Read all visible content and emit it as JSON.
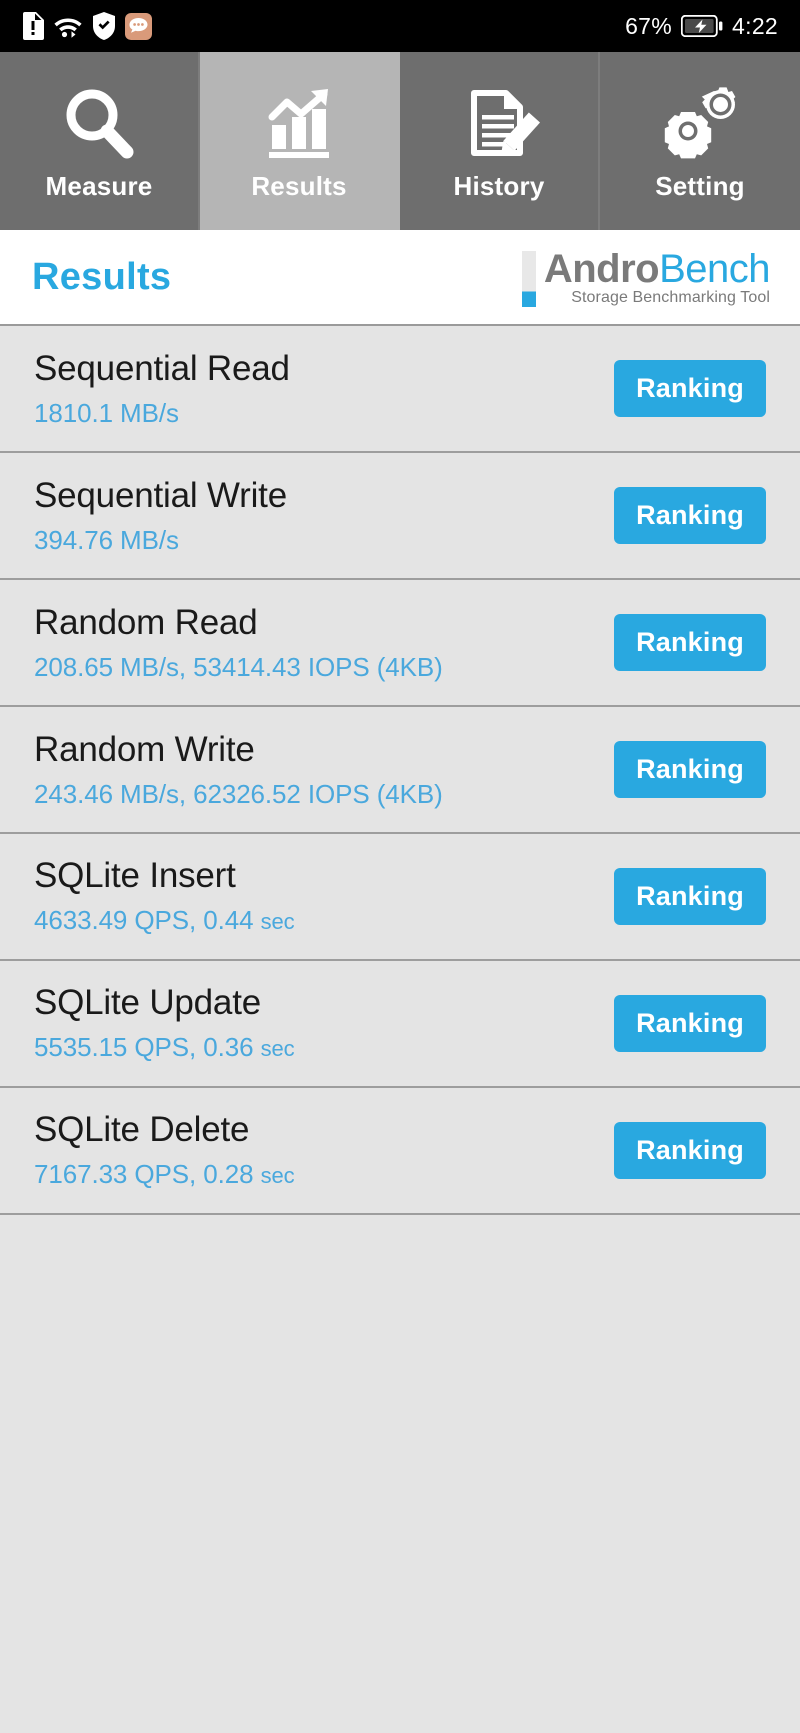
{
  "statusbar": {
    "icons_left": [
      "sim-alert-icon",
      "wifi-icon",
      "shield-check-icon",
      "message-bubble-icon"
    ],
    "battery_percent": "67%",
    "battery_icon": "battery-charging-icon",
    "time": "4:22"
  },
  "tabs": [
    {
      "id": "measure",
      "label": "Measure",
      "icon": "magnifier-icon",
      "active": false
    },
    {
      "id": "results",
      "label": "Results",
      "icon": "bar-chart-arrow-icon",
      "active": true
    },
    {
      "id": "history",
      "label": "History",
      "icon": "document-pencil-icon",
      "active": false
    },
    {
      "id": "setting",
      "label": "Setting",
      "icon": "gears-icon",
      "active": false
    }
  ],
  "header": {
    "title": "Results",
    "brand_first": "Andro",
    "brand_second": "Bench",
    "brand_tagline": "Storage Benchmarking Tool"
  },
  "colors": {
    "accent_blue": "#29a8e0",
    "value_blue": "#4aa8dd",
    "tab_inactive": "#6e6e6e",
    "tab_active": "#b5b5b5",
    "row_bg": "#e4e4e4",
    "brand_gray": "#7a7a7a"
  },
  "results": {
    "button_label": "Ranking",
    "rows": [
      {
        "name": "Sequential Read",
        "value": "1810.1 MB/s"
      },
      {
        "name": "Sequential Write",
        "value": "394.76 MB/s"
      },
      {
        "name": "Random Read",
        "value": "208.65 MB/s, 53414.43 IOPS (4KB)"
      },
      {
        "name": "Random Write",
        "value": "243.46 MB/s, 62326.52 IOPS (4KB)"
      },
      {
        "name": "SQLite Insert",
        "value": "4633.49 QPS, 0.44 sec"
      },
      {
        "name": "SQLite Update",
        "value": "5535.15 QPS, 0.36 sec"
      },
      {
        "name": "SQLite Delete",
        "value": "7167.33 QPS, 0.28 sec"
      }
    ]
  }
}
